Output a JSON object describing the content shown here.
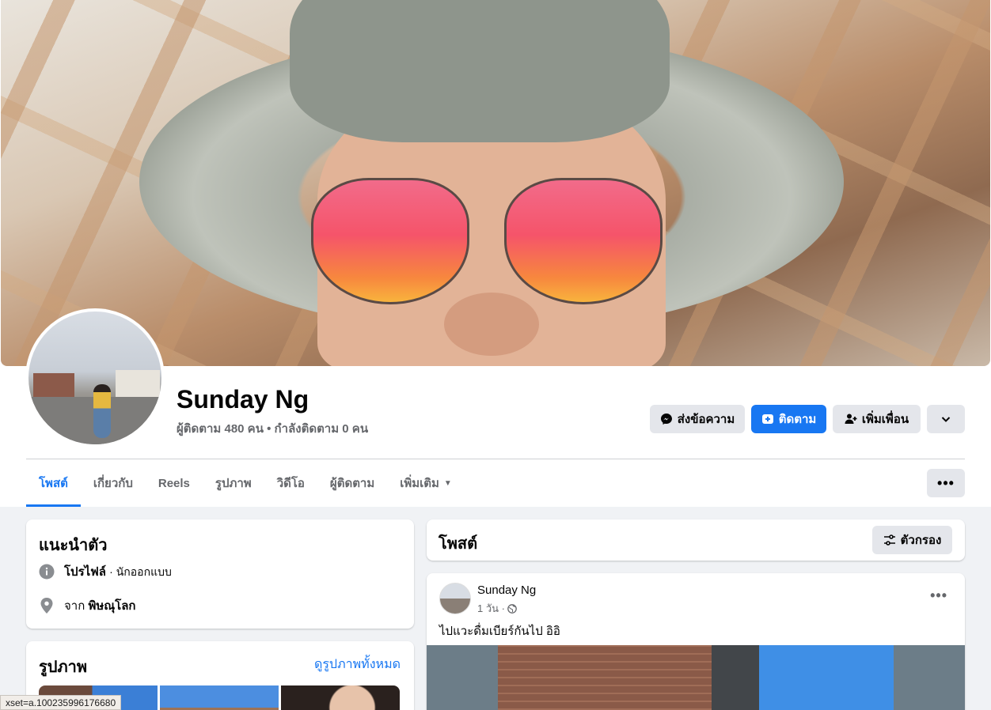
{
  "profile": {
    "name": "Sunday Ng",
    "followers_line": "ผู้ติดตาม 480 คน • กำลังติดตาม 0 คน"
  },
  "actions": {
    "message": "ส่งข้อความ",
    "follow": "ติดตาม",
    "add_friend": "เพิ่มเพื่อน"
  },
  "tabs": [
    {
      "label": "โพสต์",
      "active": true
    },
    {
      "label": "เกี่ยวกับ"
    },
    {
      "label": "Reels"
    },
    {
      "label": "รูปภาพ"
    },
    {
      "label": "วิดีโอ"
    },
    {
      "label": "ผู้ติดตาม"
    },
    {
      "label": "เพิ่มเติม"
    }
  ],
  "intro": {
    "title": "แนะนำตัว",
    "profile_label": "โปรไฟล์",
    "profile_value": "· นักออกแบบ",
    "from_prefix": "จาก",
    "from_value": "พิษณุโลก"
  },
  "photos": {
    "title": "รูปภาพ",
    "see_all": "ดูรูปภาพทั้งหมด"
  },
  "posts": {
    "title": "โพสต์",
    "filter": "ตัวกรอง"
  },
  "post": {
    "author": "Sunday Ng",
    "time": "1 วัน ·",
    "text": "ไปแวะดื่มเบียร์กันไป อิอิ"
  },
  "status_bar": {
    "url": "xset=a.100235996176680"
  },
  "colors": {
    "accent": "#1877f2",
    "button_gray": "#e4e6eb",
    "page_bg": "#f0f2f5"
  }
}
